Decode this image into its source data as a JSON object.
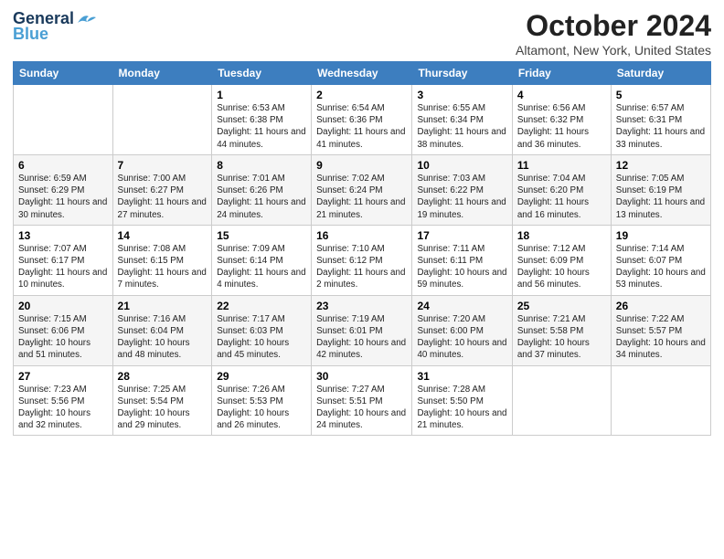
{
  "header": {
    "logo_general": "General",
    "logo_blue": "Blue",
    "title": "October 2024",
    "location": "Altamont, New York, United States"
  },
  "days_of_week": [
    "Sunday",
    "Monday",
    "Tuesday",
    "Wednesday",
    "Thursday",
    "Friday",
    "Saturday"
  ],
  "weeks": [
    [
      {
        "day": "",
        "info": ""
      },
      {
        "day": "",
        "info": ""
      },
      {
        "day": "1",
        "info": "Sunrise: 6:53 AM\nSunset: 6:38 PM\nDaylight: 11 hours and 44 minutes."
      },
      {
        "day": "2",
        "info": "Sunrise: 6:54 AM\nSunset: 6:36 PM\nDaylight: 11 hours and 41 minutes."
      },
      {
        "day": "3",
        "info": "Sunrise: 6:55 AM\nSunset: 6:34 PM\nDaylight: 11 hours and 38 minutes."
      },
      {
        "day": "4",
        "info": "Sunrise: 6:56 AM\nSunset: 6:32 PM\nDaylight: 11 hours and 36 minutes."
      },
      {
        "day": "5",
        "info": "Sunrise: 6:57 AM\nSunset: 6:31 PM\nDaylight: 11 hours and 33 minutes."
      }
    ],
    [
      {
        "day": "6",
        "info": "Sunrise: 6:59 AM\nSunset: 6:29 PM\nDaylight: 11 hours and 30 minutes."
      },
      {
        "day": "7",
        "info": "Sunrise: 7:00 AM\nSunset: 6:27 PM\nDaylight: 11 hours and 27 minutes."
      },
      {
        "day": "8",
        "info": "Sunrise: 7:01 AM\nSunset: 6:26 PM\nDaylight: 11 hours and 24 minutes."
      },
      {
        "day": "9",
        "info": "Sunrise: 7:02 AM\nSunset: 6:24 PM\nDaylight: 11 hours and 21 minutes."
      },
      {
        "day": "10",
        "info": "Sunrise: 7:03 AM\nSunset: 6:22 PM\nDaylight: 11 hours and 19 minutes."
      },
      {
        "day": "11",
        "info": "Sunrise: 7:04 AM\nSunset: 6:20 PM\nDaylight: 11 hours and 16 minutes."
      },
      {
        "day": "12",
        "info": "Sunrise: 7:05 AM\nSunset: 6:19 PM\nDaylight: 11 hours and 13 minutes."
      }
    ],
    [
      {
        "day": "13",
        "info": "Sunrise: 7:07 AM\nSunset: 6:17 PM\nDaylight: 11 hours and 10 minutes."
      },
      {
        "day": "14",
        "info": "Sunrise: 7:08 AM\nSunset: 6:15 PM\nDaylight: 11 hours and 7 minutes."
      },
      {
        "day": "15",
        "info": "Sunrise: 7:09 AM\nSunset: 6:14 PM\nDaylight: 11 hours and 4 minutes."
      },
      {
        "day": "16",
        "info": "Sunrise: 7:10 AM\nSunset: 6:12 PM\nDaylight: 11 hours and 2 minutes."
      },
      {
        "day": "17",
        "info": "Sunrise: 7:11 AM\nSunset: 6:11 PM\nDaylight: 10 hours and 59 minutes."
      },
      {
        "day": "18",
        "info": "Sunrise: 7:12 AM\nSunset: 6:09 PM\nDaylight: 10 hours and 56 minutes."
      },
      {
        "day": "19",
        "info": "Sunrise: 7:14 AM\nSunset: 6:07 PM\nDaylight: 10 hours and 53 minutes."
      }
    ],
    [
      {
        "day": "20",
        "info": "Sunrise: 7:15 AM\nSunset: 6:06 PM\nDaylight: 10 hours and 51 minutes."
      },
      {
        "day": "21",
        "info": "Sunrise: 7:16 AM\nSunset: 6:04 PM\nDaylight: 10 hours and 48 minutes."
      },
      {
        "day": "22",
        "info": "Sunrise: 7:17 AM\nSunset: 6:03 PM\nDaylight: 10 hours and 45 minutes."
      },
      {
        "day": "23",
        "info": "Sunrise: 7:19 AM\nSunset: 6:01 PM\nDaylight: 10 hours and 42 minutes."
      },
      {
        "day": "24",
        "info": "Sunrise: 7:20 AM\nSunset: 6:00 PM\nDaylight: 10 hours and 40 minutes."
      },
      {
        "day": "25",
        "info": "Sunrise: 7:21 AM\nSunset: 5:58 PM\nDaylight: 10 hours and 37 minutes."
      },
      {
        "day": "26",
        "info": "Sunrise: 7:22 AM\nSunset: 5:57 PM\nDaylight: 10 hours and 34 minutes."
      }
    ],
    [
      {
        "day": "27",
        "info": "Sunrise: 7:23 AM\nSunset: 5:56 PM\nDaylight: 10 hours and 32 minutes."
      },
      {
        "day": "28",
        "info": "Sunrise: 7:25 AM\nSunset: 5:54 PM\nDaylight: 10 hours and 29 minutes."
      },
      {
        "day": "29",
        "info": "Sunrise: 7:26 AM\nSunset: 5:53 PM\nDaylight: 10 hours and 26 minutes."
      },
      {
        "day": "30",
        "info": "Sunrise: 7:27 AM\nSunset: 5:51 PM\nDaylight: 10 hours and 24 minutes."
      },
      {
        "day": "31",
        "info": "Sunrise: 7:28 AM\nSunset: 5:50 PM\nDaylight: 10 hours and 21 minutes."
      },
      {
        "day": "",
        "info": ""
      },
      {
        "day": "",
        "info": ""
      }
    ]
  ]
}
